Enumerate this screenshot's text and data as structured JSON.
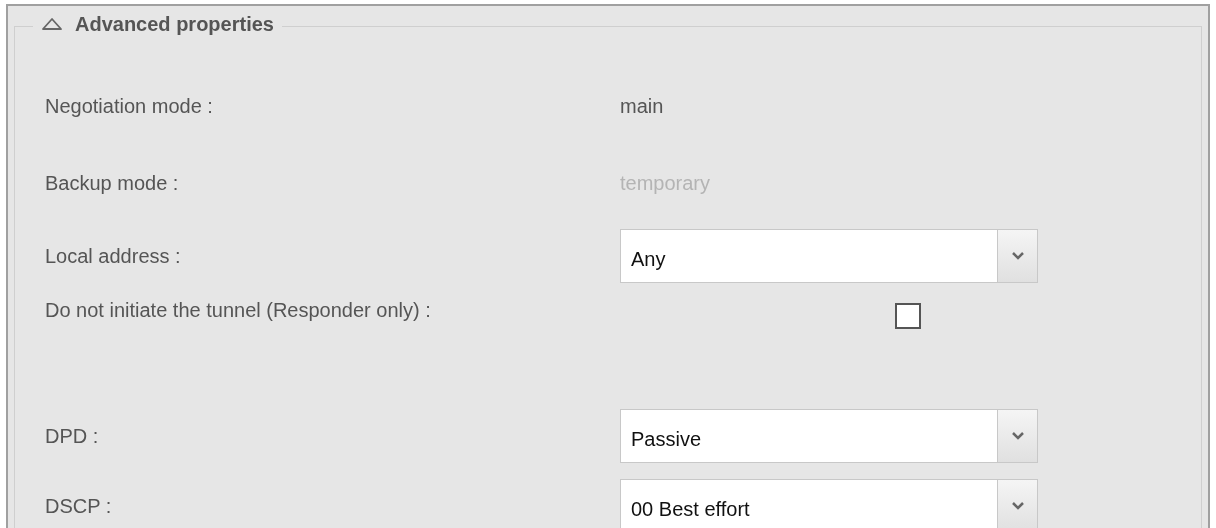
{
  "section": {
    "title": "Advanced properties",
    "expanded": true
  },
  "rows": [
    {
      "kind": "text",
      "label": "Negotiation mode :",
      "value": "main",
      "disabled": false
    },
    {
      "kind": "text",
      "label": "Backup mode :",
      "value": "temporary",
      "disabled": true
    },
    {
      "kind": "select",
      "label": "Local address :",
      "value": "Any"
    },
    {
      "kind": "checkbox",
      "label": "Do not initiate the tunnel (Responder only) :",
      "checked": false
    },
    {
      "kind": "select",
      "label": "DPD :",
      "value": "Passive"
    },
    {
      "kind": "select",
      "label": "DSCP :",
      "value": "00 Best effort"
    }
  ]
}
